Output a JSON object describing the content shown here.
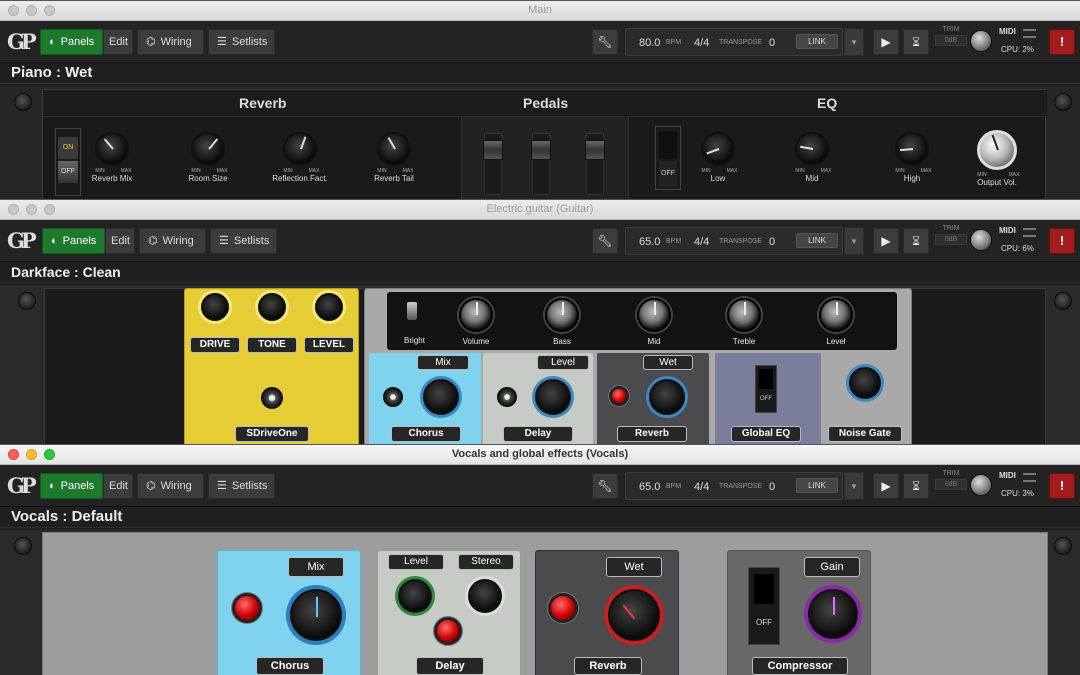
{
  "windows": [
    {
      "title": "Main",
      "bpm": "80.0",
      "cpu": "CPU: 2%",
      "panel": "Piano : Wet"
    },
    {
      "title": "Electric guitar (Guitar)",
      "bpm": "65.0",
      "cpu": "CPU: 6%",
      "panel": "Darkface : Clean"
    },
    {
      "title": "Vocals and global effects (Vocals)",
      "bpm": "65.0",
      "cpu": "CPU: 3%",
      "panel": "Vocals : Default"
    }
  ],
  "toolbar": {
    "panels": "Panels",
    "edit": "Edit",
    "wiring": "Wiring",
    "setlists": "Setlists",
    "bpm_label": "BPM",
    "time_sig": "4/4",
    "transpose_label": "TRANSPOSE",
    "transpose_value": "0",
    "link": "LINK",
    "trim": "TRIM",
    "trim_value": "0dB",
    "midi": "MIDI"
  },
  "piano": {
    "reverb_title": "Reverb",
    "pedals_title": "Pedals",
    "eq_title": "EQ",
    "switch_on": "ON",
    "switch_off": "OFF",
    "eq_switch": "OFF",
    "minmax": [
      "MIN",
      "MAX"
    ],
    "knobs": [
      "Reverb Mix",
      "Room Size",
      "Reflection Fact.",
      "Reverb Tail",
      "Low",
      "Mid",
      "High",
      "Output Vol."
    ]
  },
  "guitar": {
    "drive": "DRIVE",
    "tone": "TONE",
    "level": "LEVEL",
    "pedal": "SDriveOne",
    "bright": "Bright",
    "amp_knobs": [
      "Volume",
      "Bass",
      "Mid",
      "Treble",
      "Level"
    ],
    "chorus_param": "Mix",
    "chorus": "Chorus",
    "delay_param": "Level",
    "delay": "Delay",
    "reverb_param": "Wet",
    "reverb": "Reverb",
    "eq_off": "OFF",
    "global_eq": "Global EQ",
    "noise_gate": "Noise Gate"
  },
  "vocals": {
    "chorus_param": "Mix",
    "chorus": "Chorus",
    "delay_level": "Level",
    "delay_stereo": "Stereo",
    "delay": "Delay",
    "reverb_param": "Wet",
    "reverb": "Reverb",
    "comp_param": "Gain",
    "comp_off": "OFF",
    "compressor": "Compressor"
  },
  "colors": {
    "accent_green": "#1d7a2c",
    "alert_red": "#a31c1c",
    "yellow_pedal": "#e6cd35",
    "chorus_blue": "#7fd3ee"
  }
}
